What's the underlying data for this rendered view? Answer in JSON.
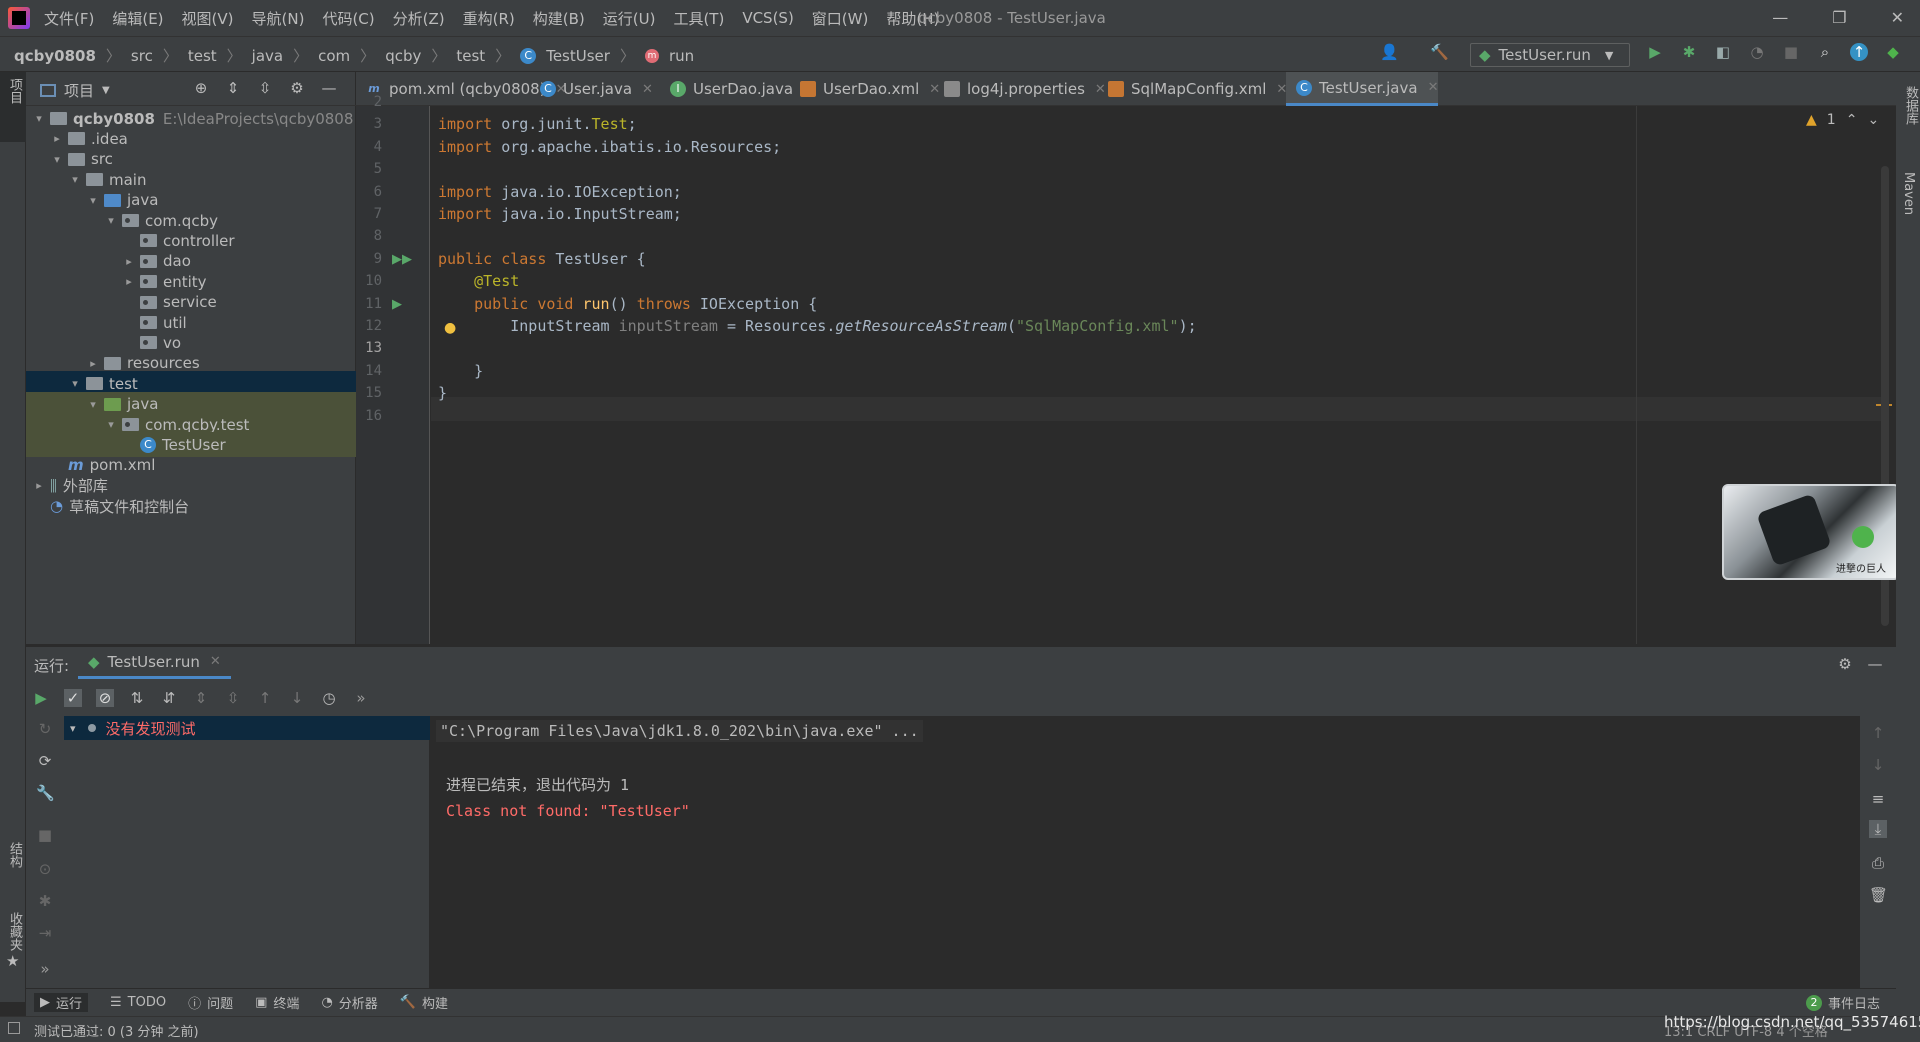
{
  "app": {
    "menu": [
      "文件(F)",
      "编辑(E)",
      "视图(V)",
      "导航(N)",
      "代码(C)",
      "分析(Z)",
      "重构(R)",
      "构建(B)",
      "运行(U)",
      "工具(T)",
      "VCS(S)",
      "窗口(W)",
      "帮助(H)"
    ],
    "window_title": "qcby0808 - TestUser.java"
  },
  "breadcrumb": [
    "qcby0808",
    "src",
    "test",
    "java",
    "com",
    "qcby",
    "test",
    "TestUser",
    "run"
  ],
  "run_config": "TestUser.run",
  "left_strip": {
    "project": "项目",
    "structure": "结构",
    "favorites": "收藏夹"
  },
  "right_strip": {
    "database": "数据库",
    "maven": "Maven"
  },
  "project_panel": {
    "title": "项目",
    "root_name": "qcby0808",
    "root_path": "E:\\IdeaProjects\\qcby0808",
    "items": [
      {
        "label": "qcby0808",
        "depth": 0,
        "arrow": "open",
        "icon": "module"
      },
      {
        "label": ".idea",
        "depth": 1,
        "arrow": "closed",
        "icon": "folder"
      },
      {
        "label": "src",
        "depth": 1,
        "arrow": "open",
        "icon": "folder"
      },
      {
        "label": "main",
        "depth": 2,
        "arrow": "open",
        "icon": "folder"
      },
      {
        "label": "java",
        "depth": 3,
        "arrow": "open",
        "icon": "folder-blue"
      },
      {
        "label": "com.qcby",
        "depth": 4,
        "arrow": "open",
        "icon": "package"
      },
      {
        "label": "controller",
        "depth": 5,
        "arrow": "none",
        "icon": "package"
      },
      {
        "label": "dao",
        "depth": 5,
        "arrow": "closed",
        "icon": "package"
      },
      {
        "label": "entity",
        "depth": 5,
        "arrow": "closed",
        "icon": "package"
      },
      {
        "label": "service",
        "depth": 5,
        "arrow": "none",
        "icon": "package"
      },
      {
        "label": "util",
        "depth": 5,
        "arrow": "none",
        "icon": "package"
      },
      {
        "label": "vo",
        "depth": 5,
        "arrow": "none",
        "icon": "package"
      },
      {
        "label": "resources",
        "depth": 3,
        "arrow": "closed",
        "icon": "folder-res"
      },
      {
        "label": "test",
        "depth": 2,
        "arrow": "open",
        "icon": "folder",
        "selected": true
      },
      {
        "label": "java",
        "depth": 3,
        "arrow": "open",
        "icon": "folder-green",
        "highlight": true
      },
      {
        "label": "com.qcby.test",
        "depth": 4,
        "arrow": "open",
        "icon": "package",
        "highlight": true
      },
      {
        "label": "TestUser",
        "depth": 5,
        "arrow": "none",
        "icon": "class",
        "highlight": true
      },
      {
        "label": "pom.xml",
        "depth": 1,
        "arrow": "none",
        "icon": "maven"
      },
      {
        "label": "外部库",
        "depth": 0,
        "arrow": "closed",
        "icon": "library"
      },
      {
        "label": "草稿文件和控制台",
        "depth": 0,
        "arrow": "none",
        "icon": "scratch"
      }
    ]
  },
  "tabs": [
    {
      "label": "pom.xml (qcby0808)",
      "icon": "m",
      "active": false
    },
    {
      "label": "User.java",
      "icon": "C",
      "active": false
    },
    {
      "label": "UserDao.java",
      "icon": "I",
      "active": false
    },
    {
      "label": "UserDao.xml",
      "icon": "xml",
      "active": false
    },
    {
      "label": "log4j.properties",
      "icon": "prop",
      "active": false
    },
    {
      "label": "SqlMapConfig.xml",
      "icon": "xml",
      "active": false
    },
    {
      "label": "TestUser.java",
      "icon": "C",
      "active": true
    }
  ],
  "editor": {
    "warning_count": "1",
    "lines": [
      {
        "n": "2",
        "html": ""
      },
      {
        "n": "3",
        "html": "<span class='kw'>import</span> org.junit.<span class='ann'>Test</span>;"
      },
      {
        "n": "4",
        "html": "<span class='kw'>import</span> org.apache.ibatis.io.Resources;"
      },
      {
        "n": "5",
        "html": ""
      },
      {
        "n": "6",
        "html": "<span class='kw'>import</span> java.io.IOException;"
      },
      {
        "n": "7",
        "html": "<span class='kw'>import</span> java.io.InputStream;"
      },
      {
        "n": "8",
        "html": ""
      },
      {
        "n": "9",
        "html": "<span class='kw'>public class</span> TestUser {"
      },
      {
        "n": "10",
        "html": "    <span class='ann'>@Test</span>"
      },
      {
        "n": "11",
        "html": "    <span class='kw'>public void</span> <span class='meth'>run</span>() <span class='kw'>throws</span> IOException {"
      },
      {
        "n": "12",
        "html": "        InputStream <span class='var'>inputStream</span> = Resources.<span class='it'>getResourceAsStream</span>(<span class='str'>\"SqlMapConfig.xml\"</span>);"
      },
      {
        "n": "13",
        "html": ""
      },
      {
        "n": "14",
        "html": "    }"
      },
      {
        "n": "15",
        "html": "}"
      },
      {
        "n": "16",
        "html": ""
      }
    ]
  },
  "run_panel": {
    "label": "运行:",
    "tab": "TestUser.run",
    "test_result": "没有发现测试",
    "console": {
      "cmd": "\"C:\\Program Files\\Java\\jdk1.8.0_202\\bin\\java.exe\" ...",
      "exit": "进程已结束，退出代码为 1",
      "error": "Class not found: \"TestUser\""
    }
  },
  "bottom_tools": [
    "运行",
    "TODO",
    "问题",
    "终端",
    "分析器",
    "构建"
  ],
  "event_log": {
    "count": "2",
    "label": "事件日志"
  },
  "status": {
    "message": "测试已通过: 0 (3 分钟 之前)",
    "right": "13:1   CRLF   UTF-8   4 个空格",
    "watermark": "https://blog.csdn.net/qq_53574615"
  },
  "colors": {
    "accent": "#4a88c7",
    "selection": "#0d293e",
    "error": "#ff6b68",
    "keyword": "#cc7832",
    "string": "#6a8759",
    "annotation": "#bbb529"
  }
}
